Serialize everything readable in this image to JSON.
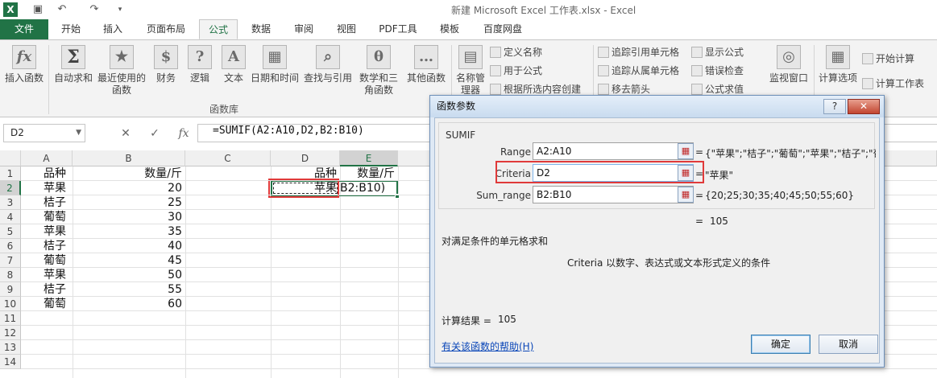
{
  "app": {
    "logo": "X",
    "title": "新建 Microsoft Excel 工作表.xlsx - Excel",
    "quick_access": [
      "save-icon",
      "undo-icon",
      "redo-icon",
      "customize-icon"
    ]
  },
  "menu": {
    "tabs": [
      "文件",
      "开始",
      "插入",
      "页面布局",
      "公式",
      "数据",
      "审阅",
      "视图",
      "PDF工具",
      "模板",
      "百度网盘"
    ],
    "active": "公式"
  },
  "ribbon": {
    "large_buttons": [
      {
        "label": "插入函数",
        "icon": "function-icon",
        "glyph": "fx"
      },
      {
        "label": "自动求和",
        "icon": "autosum-icon",
        "glyph": "Σ"
      },
      {
        "label": "最近使用的函数",
        "icon": "recent-icon",
        "glyph": "★"
      },
      {
        "label": "财务",
        "icon": "finance-icon",
        "glyph": "$"
      },
      {
        "label": "逻辑",
        "icon": "logic-icon",
        "glyph": "?"
      },
      {
        "label": "文本",
        "icon": "text-icon",
        "glyph": "A"
      },
      {
        "label": "日期和时间",
        "icon": "calendar-icon",
        "glyph": "▦"
      },
      {
        "label": "查找与引用",
        "icon": "lookup-icon",
        "glyph": "⌕"
      },
      {
        "label": "数学和三角函数",
        "icon": "math-icon",
        "glyph": "θ"
      },
      {
        "label": "其他函数",
        "icon": "more-functions-icon",
        "glyph": "…"
      },
      {
        "label": "名称管理器",
        "icon": "name-manager-icon",
        "glyph": "▤"
      }
    ],
    "names_group": [
      "定义名称",
      "用于公式",
      "根据所选内容创建"
    ],
    "audit_group": [
      "追踪引用单元格",
      "追踪从属单元格",
      "移去箭头",
      "显示公式",
      "错误检查",
      "公式求值"
    ],
    "watch_window": "监视窗口",
    "calc_options": "计算选项",
    "calc_group": [
      "开始计算",
      "计算工作表"
    ],
    "group_label": "函数库"
  },
  "formula_bar": {
    "name_box": "D2",
    "formula": "=SUMIF(A2:A10,D2,B2:B10)"
  },
  "sheet": {
    "columns": [
      "A",
      "B",
      "C",
      "D",
      "E"
    ],
    "rows": [
      "1",
      "2",
      "3",
      "4",
      "5",
      "6",
      "7",
      "8",
      "9",
      "10",
      "11",
      "12",
      "13",
      "14"
    ],
    "cells": {
      "A": [
        "品种",
        "苹果",
        "桔子",
        "葡萄",
        "苹果",
        "桔子",
        "葡萄",
        "苹果",
        "桔子",
        "葡萄"
      ],
      "B": [
        "数量/斤",
        "20",
        "25",
        "30",
        "35",
        "40",
        "45",
        "50",
        "55",
        "60"
      ],
      "D1": "品种",
      "E1": "数量/斤",
      "D2": "苹果",
      "E2": "B2:B10)"
    }
  },
  "dialog": {
    "title": "函数参数",
    "help_button": "?",
    "close_button": "✕",
    "function_name": "SUMIF",
    "args": [
      {
        "label": "Range",
        "value": "A2:A10",
        "result": "{\"苹果\";\"桔子\";\"葡萄\";\"苹果\";\"桔子\";\"葡"
      },
      {
        "label": "Criteria",
        "value": "D2",
        "result": "\"苹果\""
      },
      {
        "label": "Sum_range",
        "value": "B2:B10",
        "result": "{20;25;30;35;40;45;50;55;60}"
      }
    ],
    "equals": "=",
    "formula_result": "105",
    "description": "对满足条件的单元格求和",
    "arg_help": "Criteria   以数字、表达式或文本形式定义的条件",
    "calc_result_label": "计算结果 =",
    "calc_result_value": "105",
    "help_link": "有关该函数的帮助(H)",
    "ok": "确定",
    "cancel": "取消"
  },
  "colors": {
    "excel_green": "#217346",
    "highlight_red": "#e03a3a",
    "dialog_blue": "#dfe9f5"
  }
}
